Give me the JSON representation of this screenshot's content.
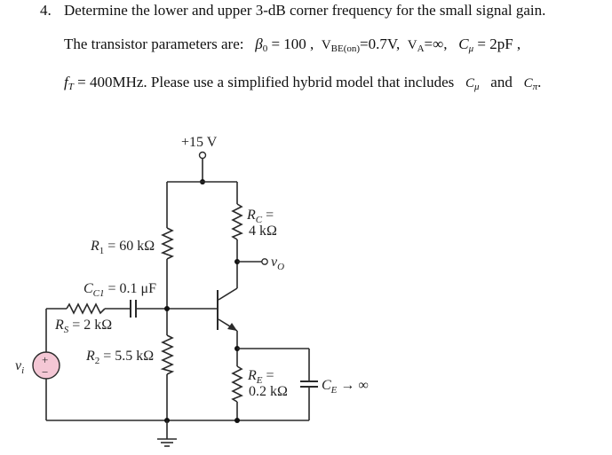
{
  "problem": {
    "number": "4.",
    "line1": "Determine the lower and upper 3-dB corner frequency for the small signal gain.",
    "line2_prefix": "The  transistor  parameters  are:",
    "beta_sym": "β",
    "beta_sub": "0",
    "beta_val": " = 100 ,",
    "vbe_main": "V",
    "vbe_sub": "BE(on)",
    "vbe_val": "=0.7V,",
    "va_main": "V",
    "va_sub": "A",
    "va_val": "=∞,",
    "cmu_sym": "C",
    "cmu_sub": "μ",
    "cmu_val": " = 2pF ,",
    "ft_sym": "f",
    "ft_sub": "T",
    "ft_val": " = 400MHz",
    "line3_text": ". Please use a simplified hybrid model that includes",
    "cmu2_sym": "C",
    "cmu2_sub": "μ",
    "and": "and",
    "cpi_sym": "C",
    "cpi_sub": "π",
    "end": "."
  },
  "circuit": {
    "supply": "+15 V",
    "r1": {
      "name": "R",
      "sub": "1",
      "value": " = 60 kΩ"
    },
    "rc": {
      "name": "R",
      "sub": "C",
      "eq": " =",
      "value": "4 kΩ"
    },
    "vo": {
      "name": "v",
      "sub": "O"
    },
    "cc1": {
      "name": "C",
      "sub": "C1",
      "value": " = 0.1 μF"
    },
    "rs": {
      "name": "R",
      "sub": "S",
      "value": " = 2 kΩ"
    },
    "r2": {
      "name": "R",
      "sub": "2",
      "value": " = 5.5 kΩ"
    },
    "vi": {
      "name": "v",
      "sub": "i"
    },
    "re": {
      "name": "R",
      "sub": "E",
      "eq": " =",
      "value": "0.2 kΩ"
    },
    "ce": {
      "name": "C",
      "sub": "E",
      "value": " → ∞"
    },
    "source_plus": "+",
    "source_minus": "−",
    "source_color": "#f4c7d5"
  }
}
